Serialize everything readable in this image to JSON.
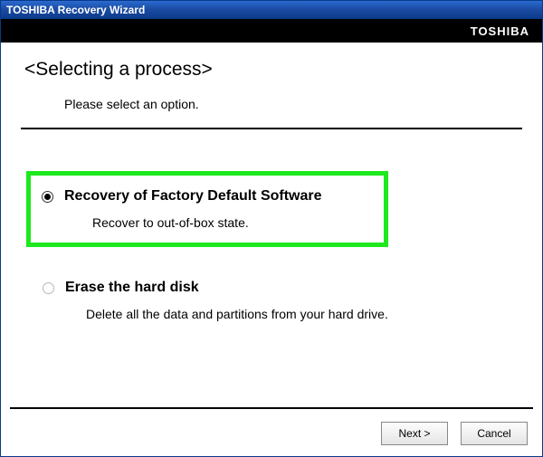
{
  "titlebar": {
    "text": "TOSHIBA Recovery Wizard"
  },
  "brand": "TOSHIBA",
  "page_title": "<Selecting a process>",
  "prompt": "Please select an option.",
  "options": [
    {
      "label": "Recovery of Factory Default Software",
      "description": "Recover to out-of-box state.",
      "selected": true
    },
    {
      "label": "Erase the hard disk",
      "description": "Delete all the data and partitions from your hard drive.",
      "selected": false
    }
  ],
  "buttons": {
    "next": "Next >",
    "cancel": "Cancel"
  }
}
